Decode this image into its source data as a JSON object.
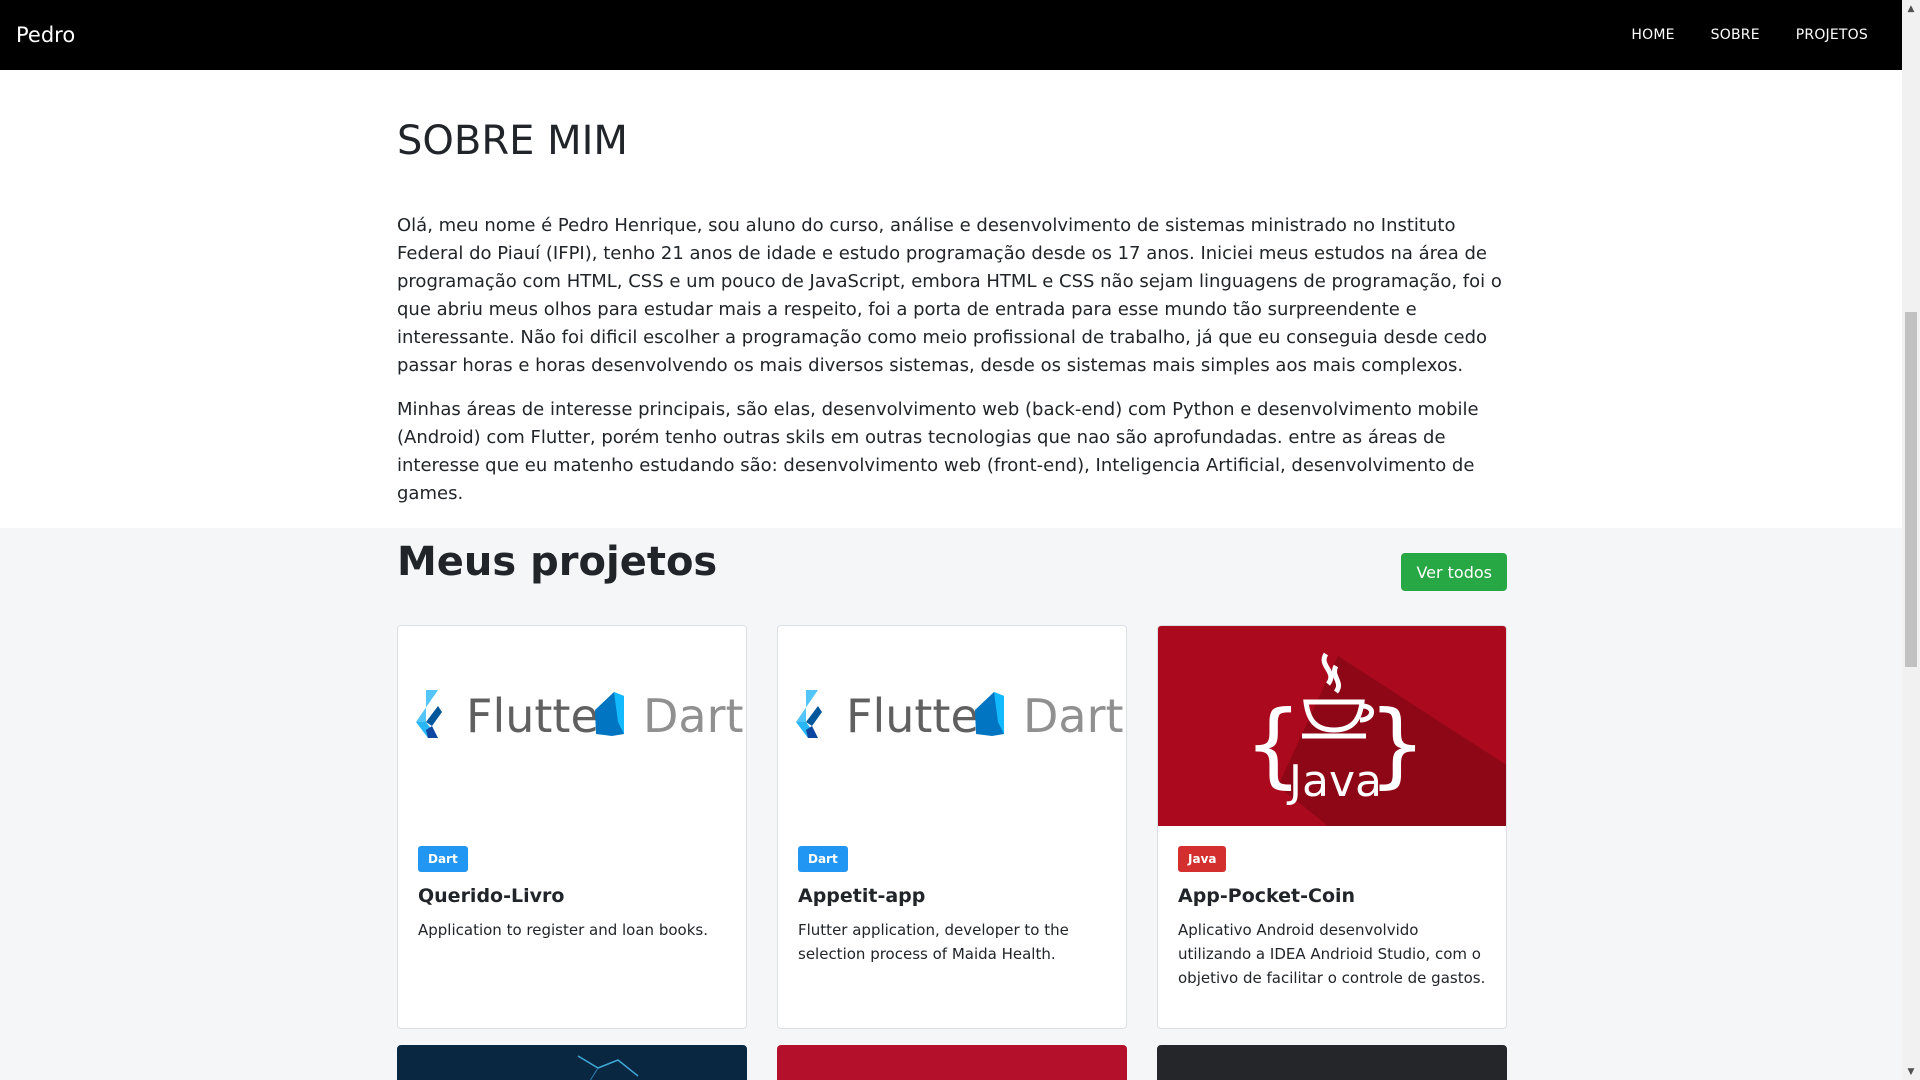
{
  "nav": {
    "brand": "Pedro",
    "links": [
      "HOME",
      "SOBRE",
      "PROJETOS"
    ]
  },
  "about": {
    "title": "SOBRE MIM",
    "paragraphs": [
      "Olá, meu nome é Pedro Henrique, sou aluno do curso, análise e desenvolvimento de sistemas ministrado no Instituto Federal do Piauí (IFPI), tenho 21 anos de idade e estudo programação desde os 17 anos. Iniciei meus estudos na área de programação com HTML, CSS e um pouco de JavaScript, embora HTML e CSS não sejam linguagens de programação, foi o que abriu meus olhos para estudar mais a respeito, foi a porta de entrada para esse mundo tão surpreendente e interessante. Não foi dificil escolher a programação como meio profissional de trabalho, já que eu conseguia desde cedo passar horas e horas desenvolvendo os mais diversos sistemas, desde os sistemas mais simples aos mais complexos.",
      "Minhas áreas de interesse principais, são elas, desenvolvimento web (back-end) com Python e desenvolvimento mobile (Android) com Flutter, porém tenho outras skils em outras tecnologias que nao são aprofundadas. entre as áreas de interesse que eu matenho estudando são: desenvolvimento web (front-end), Inteligencia Artificial, desenvolvimento de games."
    ]
  },
  "projects": {
    "title": "Meus projetos",
    "view_all": "Ver todos",
    "cards": [
      {
        "image": "flutter-dart-logo",
        "image_text_1": "Flutter",
        "image_text_2": "Dart",
        "badge": "Dart",
        "badge_color": "#2196f3",
        "title": "Querido-Livro",
        "description": "Application to register and loan books."
      },
      {
        "image": "flutter-dart-logo",
        "image_text_1": "Flutter",
        "image_text_2": "Dart",
        "badge": "Dart",
        "badge_color": "#2196f3",
        "title": "Appetit-app",
        "description": "Flutter application, developer to the selection process of Maida Health."
      },
      {
        "image": "java-logo",
        "image_text_1": "Java",
        "badge": "Java",
        "badge_color": "#d32f2f",
        "title": "App-Pocket-Coin",
        "description": "Aplicativo Android desenvolvido utilizando a IDEA Andrioid Studio, com o objetivo de facilitar o controle de gastos."
      }
    ],
    "row2_colors": [
      "#0a2742",
      "#b5102b",
      "#242629"
    ]
  },
  "colors": {
    "navbar": "#000000",
    "button_green": "#28a745",
    "java_red": "#ab0a1e"
  }
}
